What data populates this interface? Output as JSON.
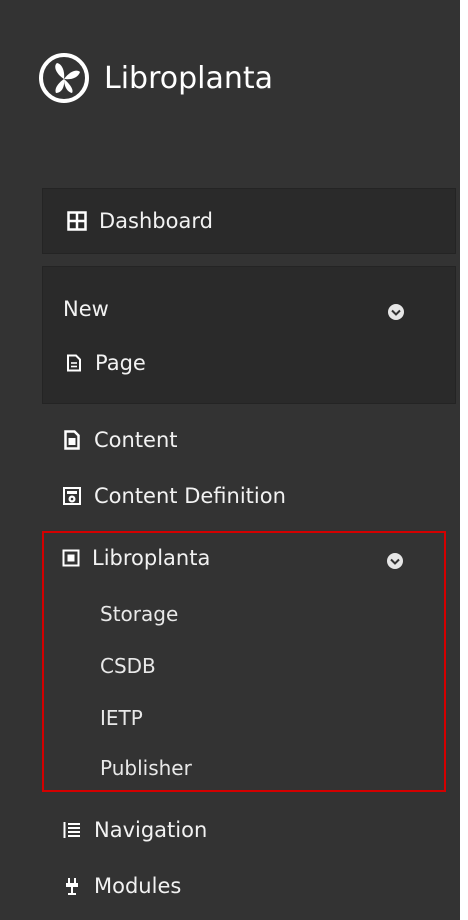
{
  "brand": {
    "name": "Libroplanta",
    "logo_icon": "leaf-logo-icon"
  },
  "dashboard": {
    "label": "Dashboard",
    "icon": "grid-icon"
  },
  "new_section": {
    "title": "New",
    "items": [
      {
        "label": "Page",
        "icon": "page-icon"
      }
    ]
  },
  "menu": {
    "content": {
      "label": "Content",
      "icon": "document-icon"
    },
    "content_definition": {
      "label": "Content Definition",
      "icon": "gear-doc-icon"
    },
    "libroplanta": {
      "label": "Libroplanta",
      "icon": "square-icon",
      "children": [
        "Storage",
        "CSDB",
        "IETP",
        "Publisher"
      ]
    },
    "navigation": {
      "label": "Navigation",
      "icon": "list-icon"
    },
    "modules": {
      "label": "Modules",
      "icon": "plug-icon"
    }
  },
  "colors": {
    "sidebar_bg": "#333333",
    "panel_bg": "#2a2a2a",
    "text": "#f2f2f2",
    "highlight_border": "#d40000"
  }
}
